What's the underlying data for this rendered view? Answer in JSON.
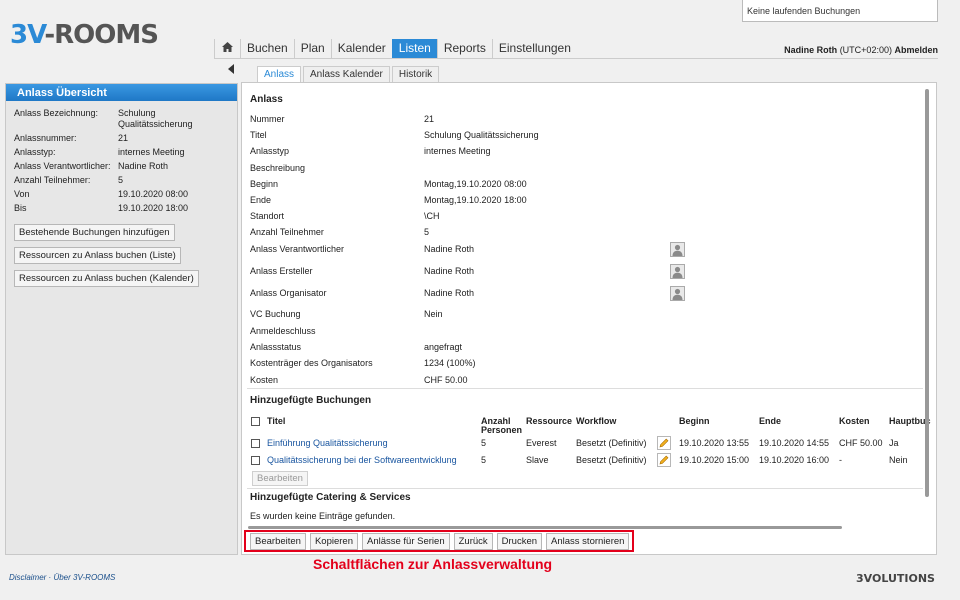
{
  "header": {
    "logo_part1": "3V",
    "logo_part2": "-ROOMS",
    "status": "Keine laufenden Buchungen",
    "user": "Nadine Roth",
    "timezone": "(UTC+02:00)",
    "logout": "Abmelden",
    "nav": [
      "Buchen",
      "Plan",
      "Kalender",
      "Listen",
      "Reports",
      "Einstellungen"
    ],
    "active_nav": "Listen",
    "accent_color": "#2b8ad6"
  },
  "left": {
    "title": "Anlass Übersicht",
    "fields": [
      {
        "label": "Anlass Bezeichnung:",
        "value": "Schulung Qualitätssicherung"
      },
      {
        "label": "Anlassnummer:",
        "value": "21"
      },
      {
        "label": "Anlasstyp:",
        "value": "internes Meeting"
      },
      {
        "label": "Anlass Verantwortlicher:",
        "value": "Nadine Roth"
      },
      {
        "label": "Anzahl Teilnehmer:",
        "value": "5"
      },
      {
        "label": "Von",
        "value": "19.10.2020 08:00"
      },
      {
        "label": "Bis",
        "value": "19.10.2020 18:00"
      }
    ],
    "buttons": [
      "Bestehende Buchungen hinzufügen",
      "Ressourcen zu Anlass buchen (Liste)",
      "Ressourcen zu Anlass buchen (Kalender)"
    ]
  },
  "tabs": [
    "Anlass",
    "Anlass Kalender",
    "Historik"
  ],
  "anlass": {
    "title": "Anlass",
    "rows": [
      {
        "label": "Nummer",
        "value": "21"
      },
      {
        "label": "Titel",
        "value": "Schulung Qualitätssicherung"
      },
      {
        "label": "Anlasstyp",
        "value": "internes Meeting"
      },
      {
        "label": "Beschreibung",
        "value": ""
      },
      {
        "label": "Beginn",
        "value": "Montag,19.10.2020 08:00"
      },
      {
        "label": "Ende",
        "value": "Montag,19.10.2020 18:00"
      },
      {
        "label": "Standort",
        "value": "\\CH"
      },
      {
        "label": "Anzahl Teilnehmer",
        "value": "5"
      },
      {
        "label": "Anlass Verantwortlicher",
        "value": "Nadine Roth"
      },
      {
        "label": "Anlass Ersteller",
        "value": "Nadine Roth"
      },
      {
        "label": "Anlass Organisator",
        "value": "Nadine Roth"
      },
      {
        "label": "VC Buchung",
        "value": "Nein"
      },
      {
        "label": "Anmeldeschluss",
        "value": ""
      },
      {
        "label": "Anlassstatus",
        "value": "angefragt"
      },
      {
        "label": "Kostenträger des Organisators",
        "value": "1234 (100%)"
      },
      {
        "label": "Kosten",
        "value": "CHF 50.00"
      }
    ]
  },
  "bookings": {
    "title": "Hinzugefügte Buchungen",
    "headers": {
      "titel": "Titel",
      "anzahl1": "Anzahl",
      "anzahl2": "Personen",
      "ressource": "Ressource",
      "workflow": "Workflow",
      "beginn": "Beginn",
      "ende": "Ende",
      "kosten": "Kosten",
      "haupt": "Hauptbuc"
    },
    "rows": [
      {
        "titel": "Einführung Qualitätssicherung",
        "anzahl": "5",
        "ressource": "Everest",
        "workflow": "Besetzt (Definitiv)",
        "beginn": "19.10.2020 13:55",
        "ende": "19.10.2020 14:55",
        "kosten": "CHF 50.00",
        "haupt": "Ja"
      },
      {
        "titel": "Qualitätssicherung bei der Softwareentwicklung",
        "anzahl": "5",
        "ressource": "Slave",
        "workflow": "Besetzt (Definitiv)",
        "beginn": "19.10.2020 15:00",
        "ende": "19.10.2020 16:00",
        "kosten": "-",
        "haupt": "Nein"
      }
    ],
    "edit_button": "Bearbeiten"
  },
  "catering": {
    "title": "Hinzugefügte Catering & Services",
    "empty": "Es wurden keine Einträge gefunden."
  },
  "actions": [
    "Bearbeiten",
    "Kopieren",
    "Anlässe für Serien",
    "Zurück",
    "Drucken",
    "Anlass stornieren"
  ],
  "callout": "Schaltflächen zur Anlassverwaltung",
  "footer": {
    "links": "Disclaimer  ·  Über 3V-ROOMS",
    "brand": "3VOLUTIONS"
  }
}
